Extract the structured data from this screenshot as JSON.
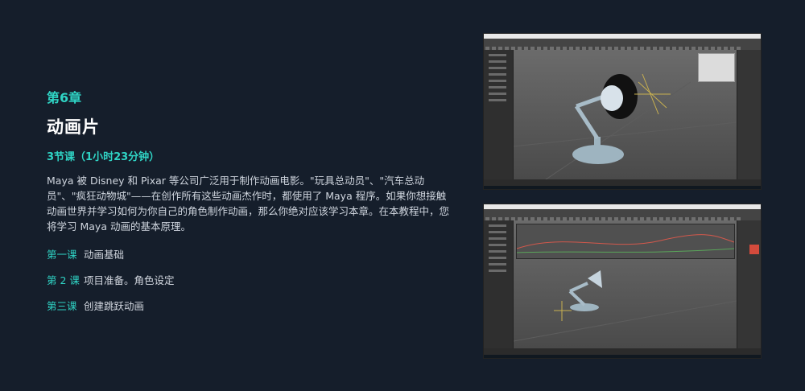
{
  "chapter": "第6章",
  "title": "动画片",
  "lessons_count": "3节课（1小时23分钟）",
  "description": "Maya 被 Disney 和 Pixar 等公司广泛用于制作动画电影。\"玩具总动员\"、\"汽车总动员\"、\"疯狂动物城\"——在创作所有这些动画杰作时，都使用了 Maya 程序。如果你想接触动画世界并学习如何为你自己的角色制作动画，那么你绝对应该学习本章。在本教程中，您将学习 Maya 动画的基本原理。",
  "lessons": [
    {
      "num": "第一课",
      "name": "动画基础"
    },
    {
      "num": "第 2 课",
      "name": "项目准备。角色设定"
    },
    {
      "num": "第三课",
      "name": "创建跳跃动画"
    }
  ],
  "colors": {
    "background": "#151e2b",
    "accent": "#2fd3c4"
  }
}
